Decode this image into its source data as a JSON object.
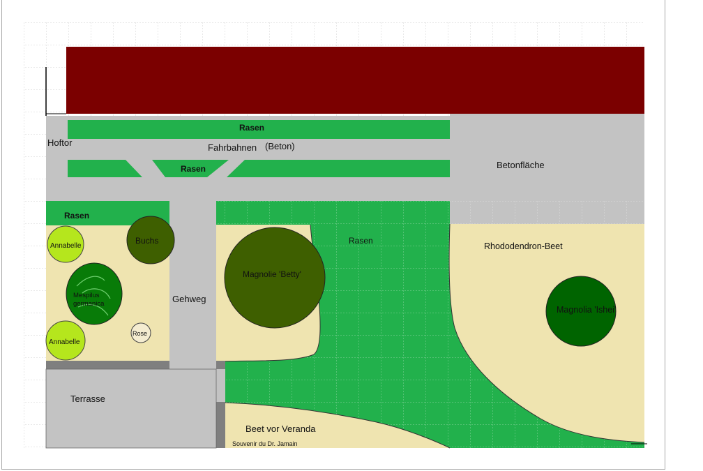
{
  "labels": {
    "hoftor": "Hoftor",
    "rasen_top": "Rasen",
    "fahrbahnen": "Fahrbahnen",
    "beton_paren": "(Beton)",
    "rasen_mid": "Rasen",
    "betonflaeche": "Betonfläche",
    "rasen_left": "Rasen",
    "annabelle_1": "Annabelle",
    "buchs": "Buchs",
    "mespilus_1": "Mespilus",
    "mespilus_2": "germanica",
    "annabelle_2": "Annabelle",
    "rose": "Rose",
    "gehweg": "Gehweg",
    "magnolie_betty": "Magnolie 'Betty'",
    "rasen_big": "Rasen",
    "rhododendron": "Rhododendron-Beet",
    "magnolia_ishei": "Magnolia 'Ishei'",
    "terrasse": "Terrasse",
    "beet_veranda": "Beet vor Veranda",
    "souvenir": "Souvenir du Dr. Jamain"
  },
  "colors": {
    "roof": "#7b0000",
    "lawn": "#22b14c",
    "concrete": "#c3c3c3",
    "bed": "#efe4b0",
    "dark_gray": "#7f7f7f",
    "olive": "#3e5f00",
    "hydrangea": "#b5e61d",
    "dark_green": "#087b08",
    "magnolia_ishei": "#006400"
  }
}
